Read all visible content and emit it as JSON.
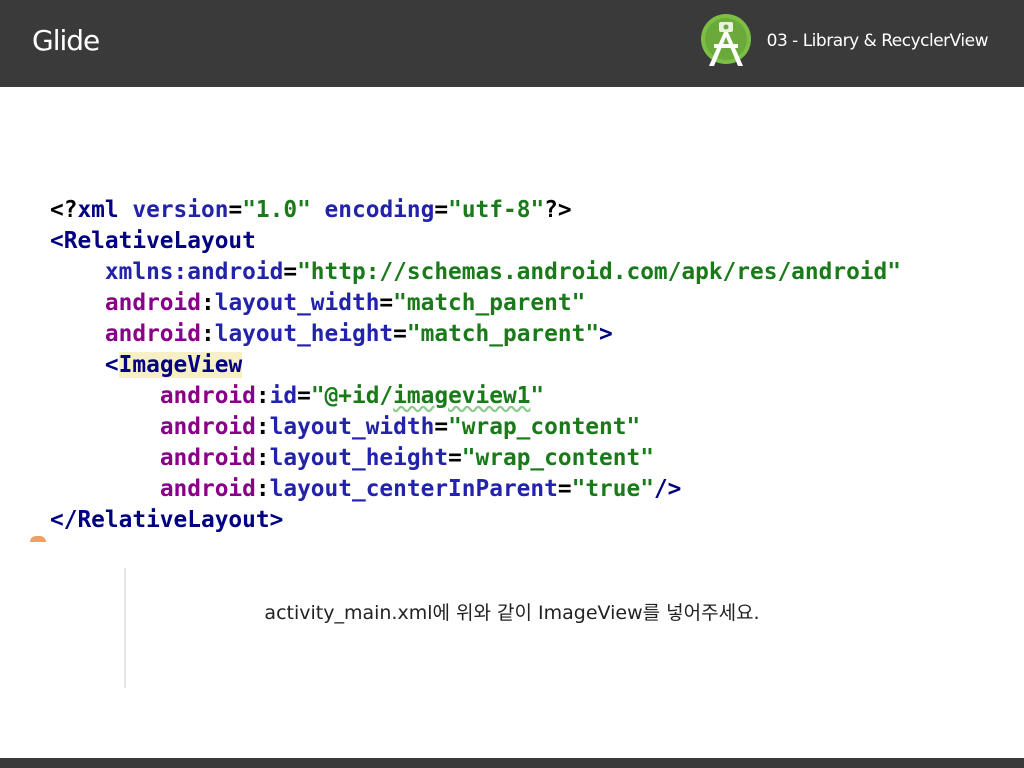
{
  "header": {
    "title": "Glide",
    "subtitle": "03 - Library & RecyclerView",
    "logo": "android-studio-logo"
  },
  "code": {
    "line1": {
      "open": "<?",
      "tag": "xml",
      "attr1": "version",
      "eq1": "=",
      "val1": "\"1.0\"",
      "attr2": "encoding",
      "eq2": "=",
      "val2": "\"utf-8\"",
      "close": "?>"
    },
    "line2": {
      "open": "<",
      "tag": "RelativeLayout"
    },
    "line3": {
      "ns": "xmlns:",
      "attr": "android",
      "eq": "=",
      "val": "\"http://schemas.android.com/apk/res/android\""
    },
    "line4": {
      "ns": "android",
      "colon": ":",
      "attr": "layout_width",
      "eq": "=",
      "val": "\"match_parent\""
    },
    "line5": {
      "ns": "android",
      "colon": ":",
      "attr": "layout_height",
      "eq": "=",
      "val": "\"match_parent\"",
      "close": ">"
    },
    "line6": {
      "open": "<",
      "tag": "ImageView"
    },
    "line7": {
      "ns": "android",
      "colon": ":",
      "attr": "id",
      "eq": "=",
      "val_a": "\"@+id/",
      "val_b": "imageview1",
      "val_c": "\""
    },
    "line8": {
      "ns": "android",
      "colon": ":",
      "attr": "layout_width",
      "eq": "=",
      "val": "\"wrap_content\""
    },
    "line9": {
      "ns": "android",
      "colon": ":",
      "attr": "layout_height",
      "eq": "=",
      "val": "\"wrap_content\""
    },
    "line10": {
      "ns": "android",
      "colon": ":",
      "attr": "layout_centerInParent",
      "eq": "=",
      "val": "\"true\"",
      "close": "/>"
    },
    "line11": {
      "open": "</",
      "tag": "RelativeLayout",
      "close": ">"
    }
  },
  "caption": "activity_main.xml에 위와 같이 ImageView를 넣어주세요.",
  "colors": {
    "header_bg": "#3a3a3a",
    "tag": "#000080",
    "attribute": "#2222aa",
    "namespace": "#880088",
    "value": "#1a7a1a",
    "highlight": "#f7f0c6"
  }
}
